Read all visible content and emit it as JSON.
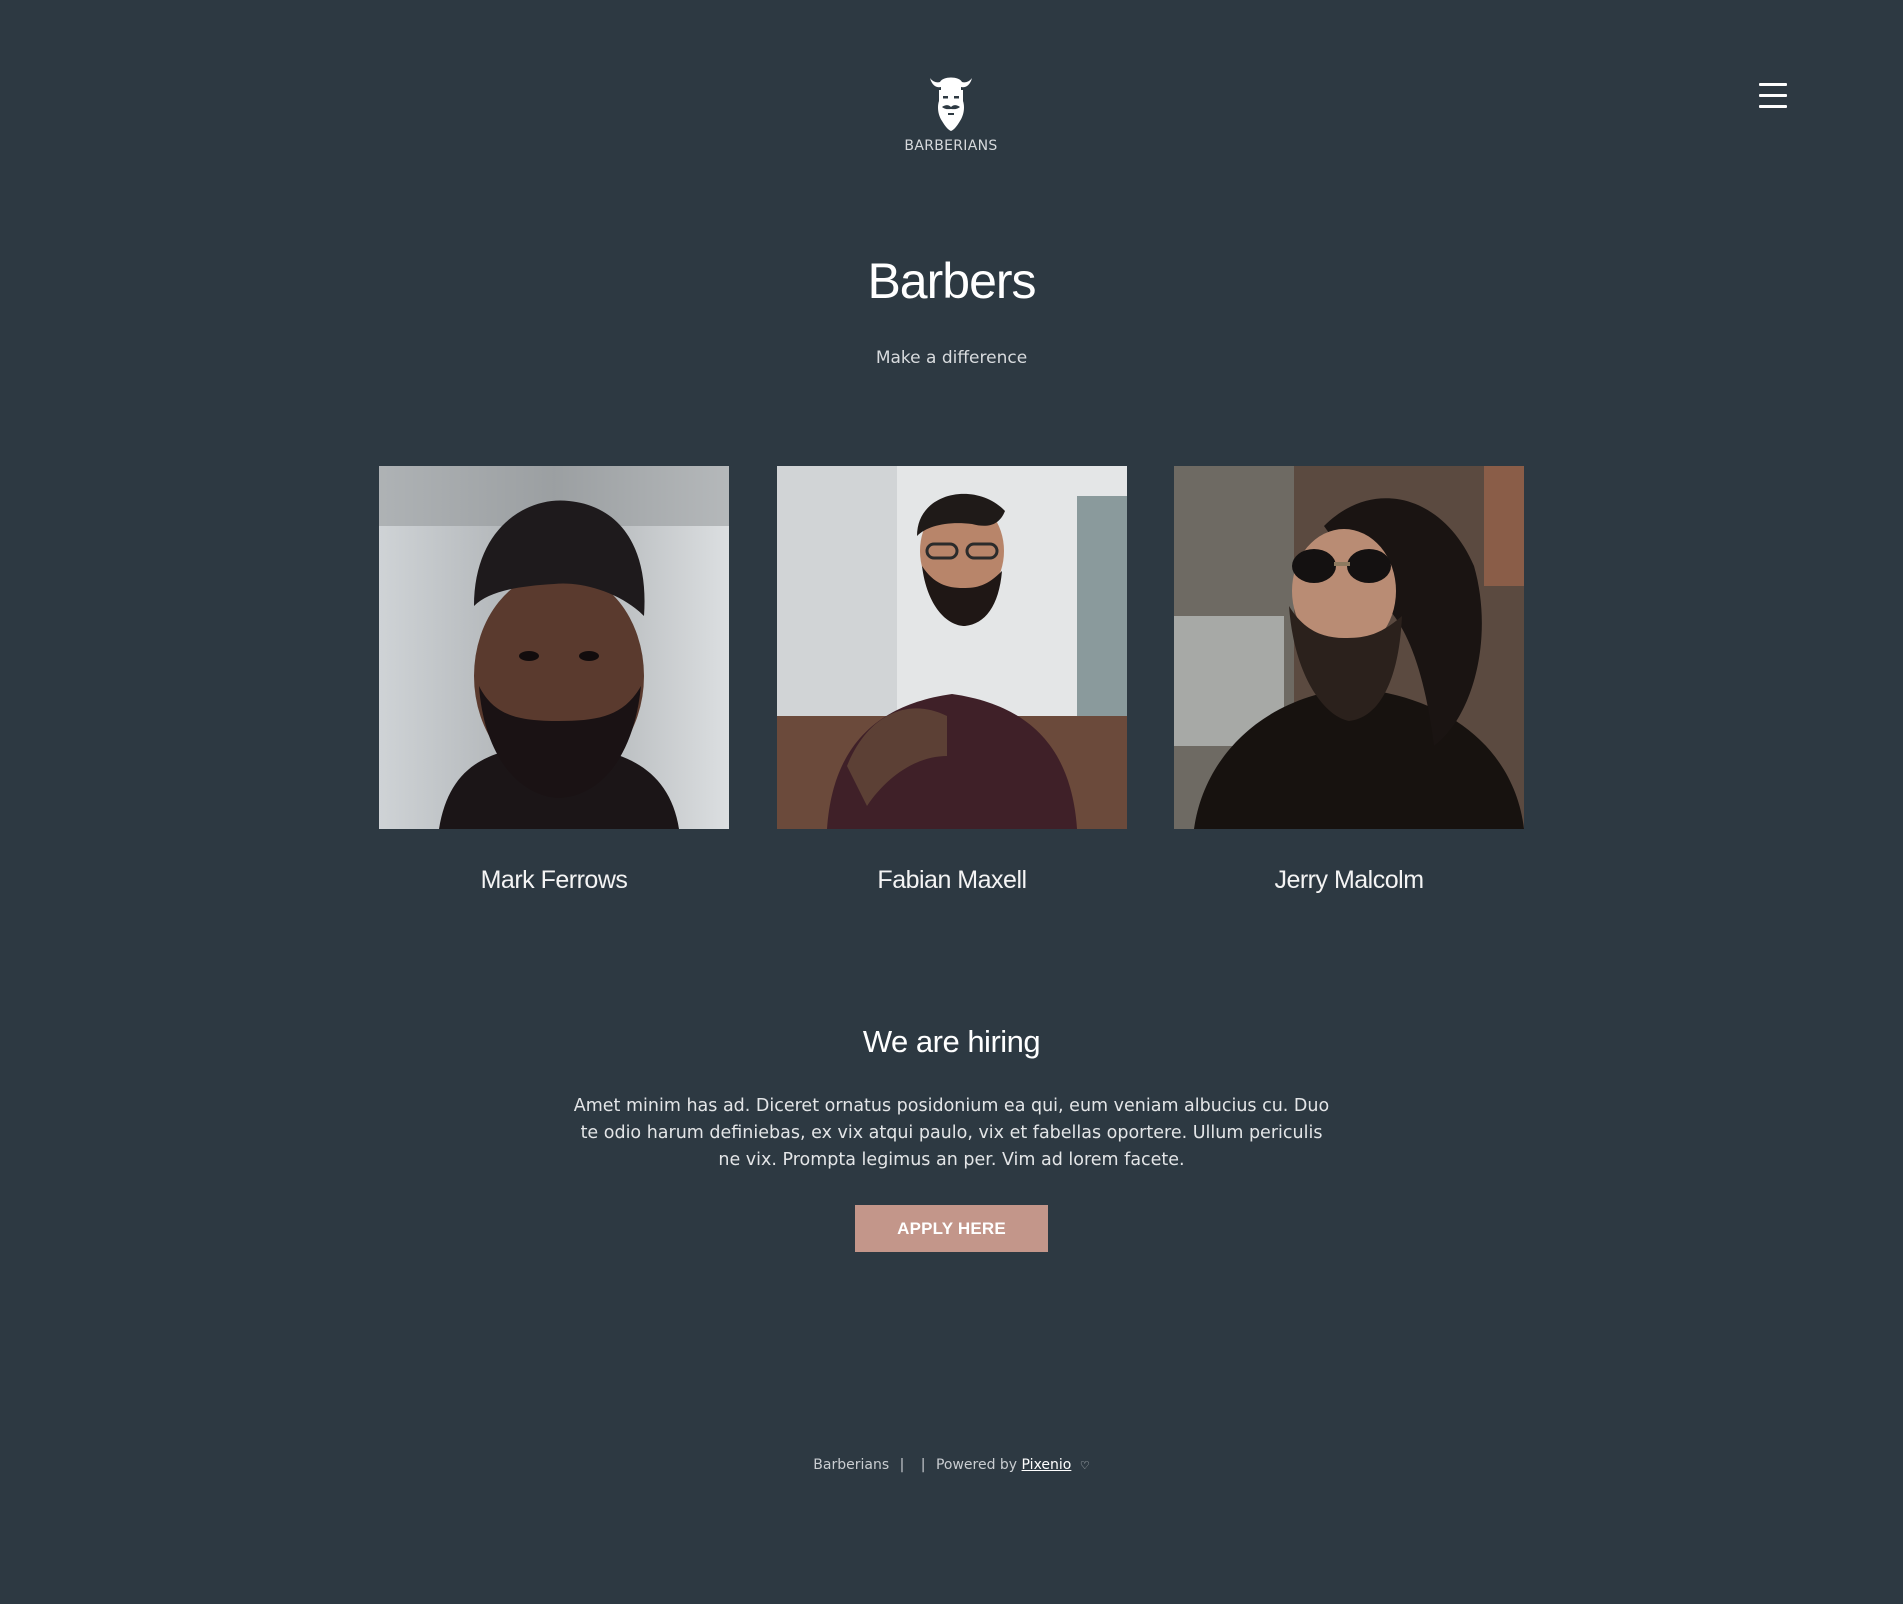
{
  "header": {
    "brand_name": "BARBERIANS",
    "logo_icon": "bearded-viking-icon",
    "menu_icon": "hamburger-menu-icon"
  },
  "intro": {
    "title": "Barbers",
    "subtitle": "Make a difference"
  },
  "barbers": [
    {
      "name": "Mark Ferrows",
      "photo": "portrait-photo"
    },
    {
      "name": "Fabian Maxell",
      "photo": "portrait-photo"
    },
    {
      "name": "Jerry Malcolm",
      "photo": "portrait-photo"
    }
  ],
  "hiring": {
    "title": "We are hiring",
    "text": "Amet minim has ad. Diceret ornatus posidonium ea qui, eum veniam albucius cu. Duo te odio harum definiebas, ex vix atqui paulo, vix et fabellas oportere. Ullum periculis ne vix. Prompta legimus an per. Vim ad lorem facete.",
    "button_label": "APPLY HERE"
  },
  "footer": {
    "brand": "Barberians",
    "separator_1": "|",
    "separator_2": "|",
    "powered_by": "Powered by",
    "link_text": "Pixenio",
    "heart": "♡"
  },
  "colors": {
    "background": "#2d3942",
    "accent_button": "#c3968a",
    "text_primary": "#ffffff"
  }
}
